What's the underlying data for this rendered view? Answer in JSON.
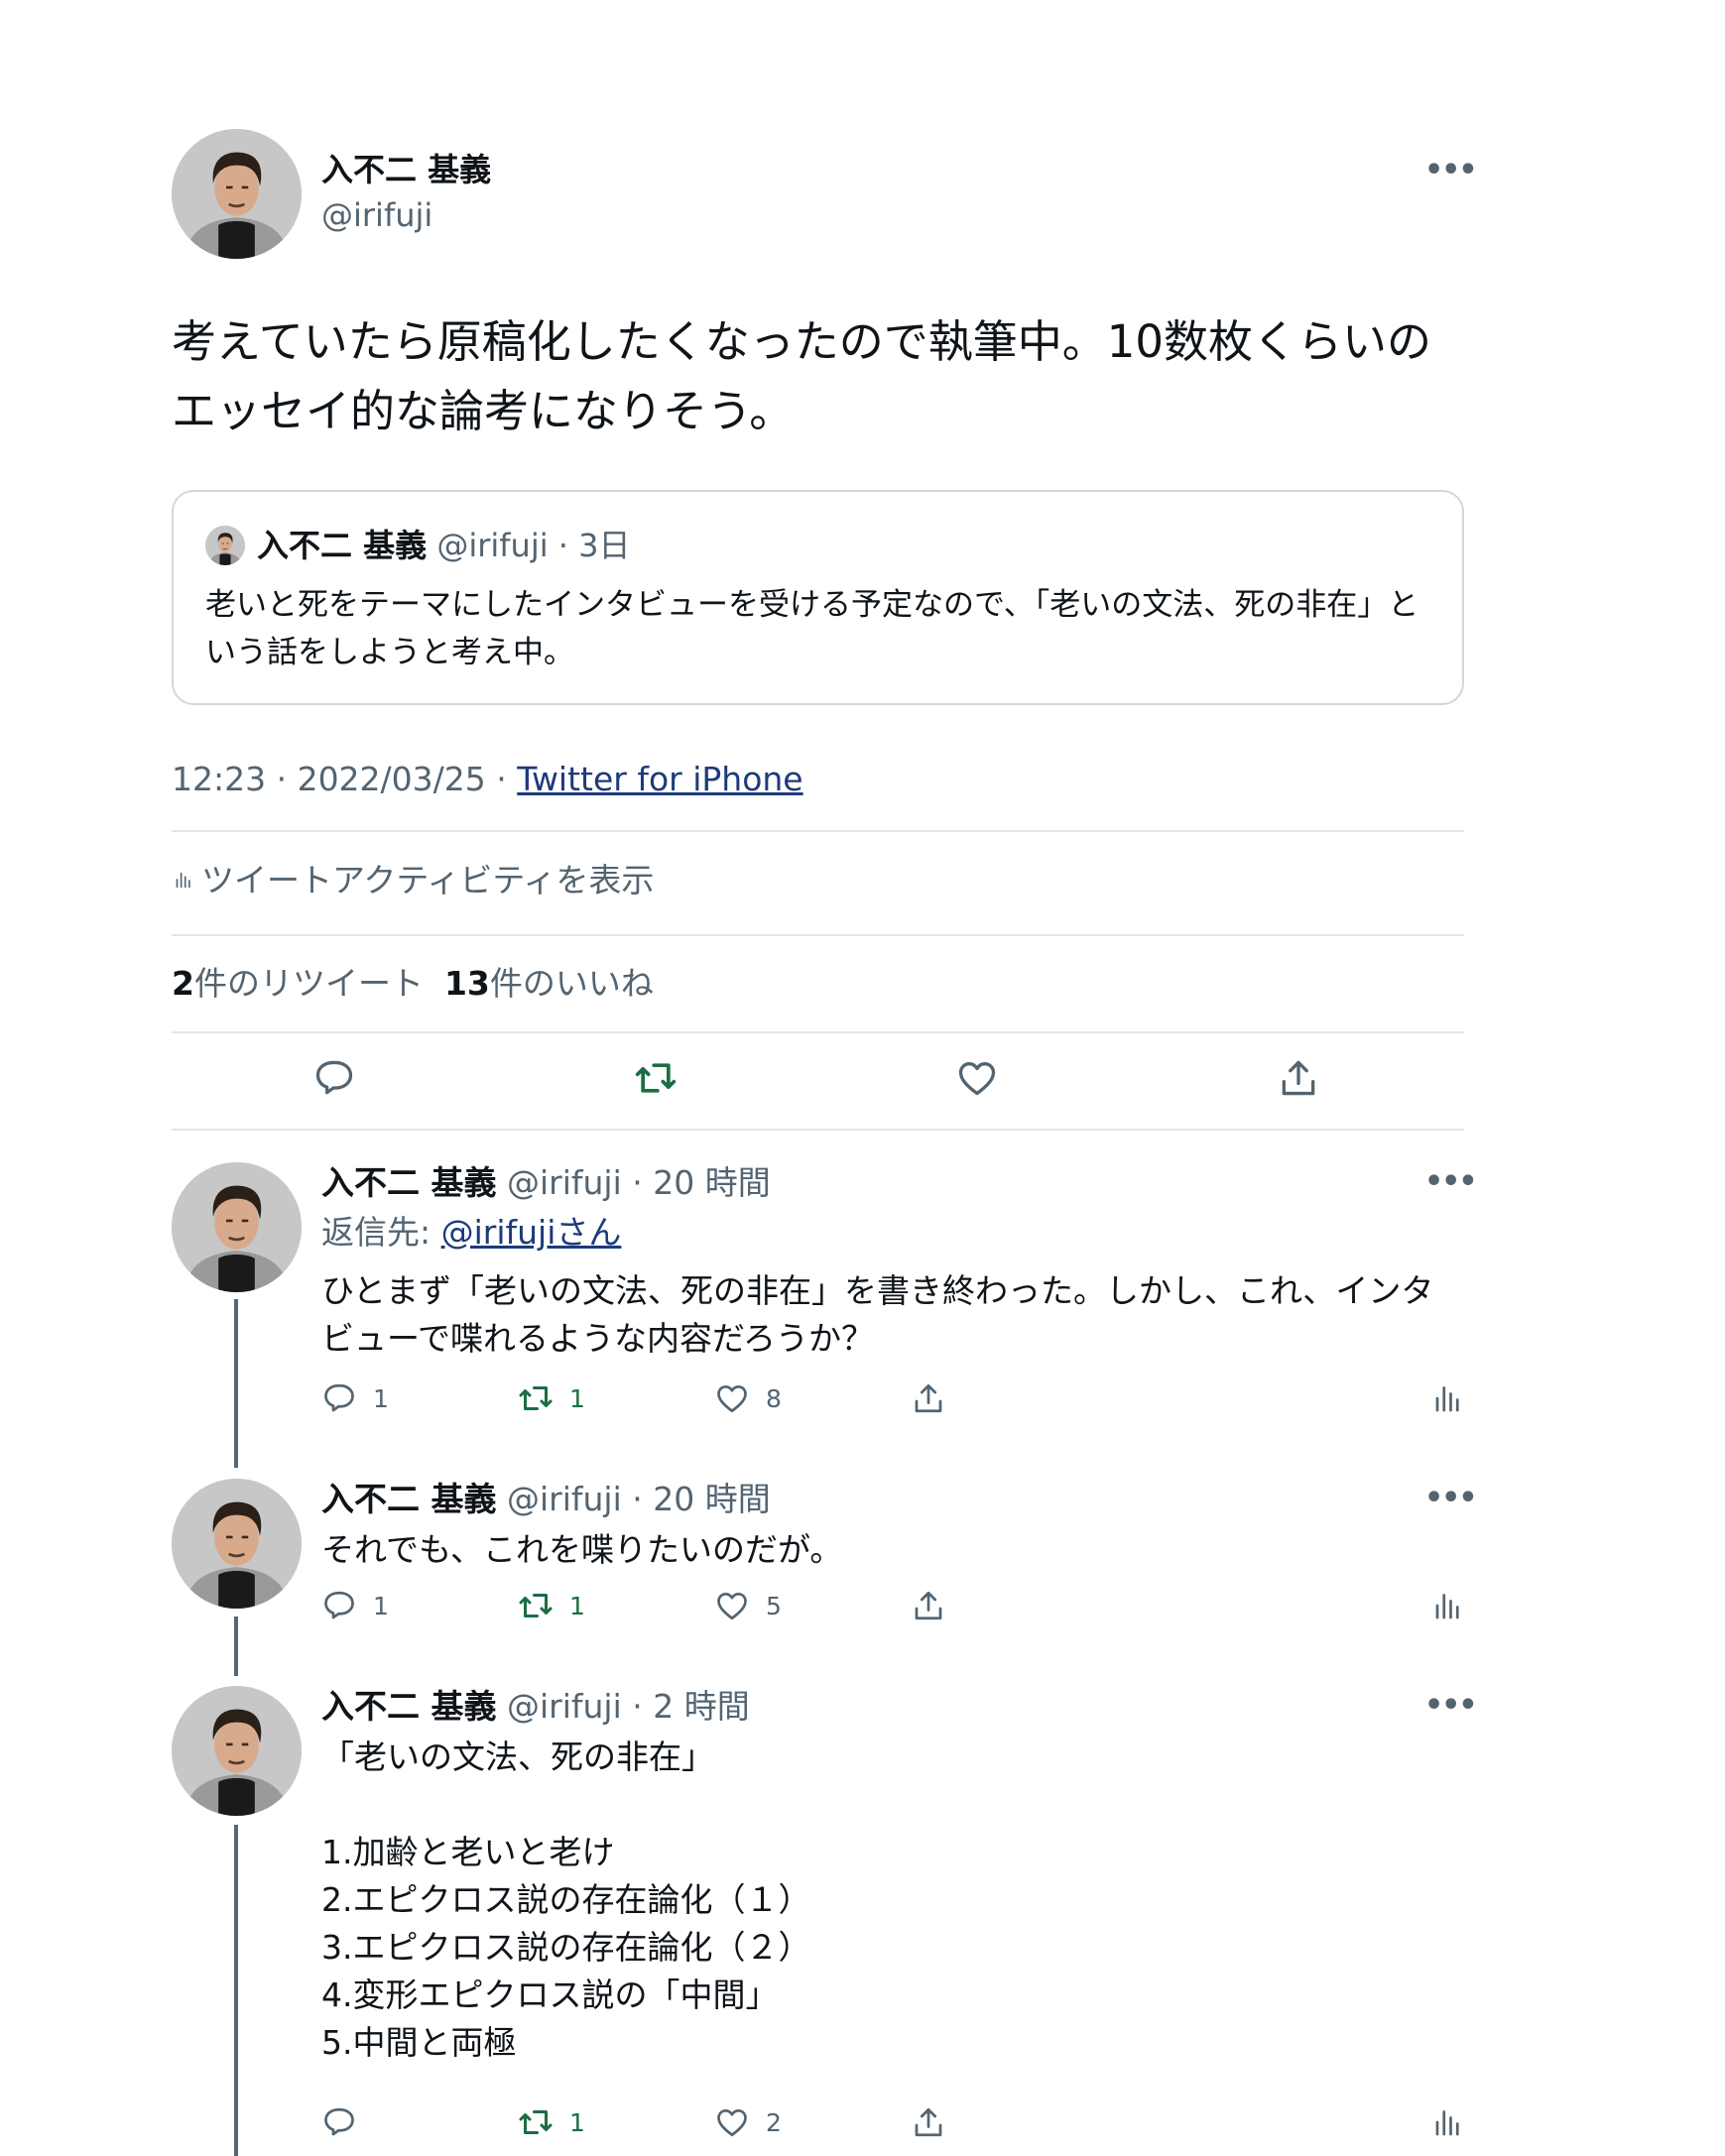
{
  "main": {
    "name": "入不二 基義",
    "handle": "@irifuji",
    "text": "考えていたら原稿化したくなったので執筆中。10数枚くらいのエッセイ的な論考になりそう。",
    "more_icon": "more-dots-icon"
  },
  "quote": {
    "name": "入不二 基義",
    "meta": "@irifuji · 3日",
    "text": "老いと死をテーマにしたインタビューを受ける予定なので、「老いの文法、死の非在」という話をしようと考え中。"
  },
  "timestamp": {
    "time": "12:23 · 2022/03/25 · ",
    "source": "Twitter for iPhone"
  },
  "activity_label": "ツイートアクティビティを表示",
  "stats": {
    "retweets_count": "2",
    "retweets_label": "件のリツイート",
    "likes_count": "13",
    "likes_label": "件のいいね"
  },
  "colors": {
    "retweet": "#1a6e45",
    "secondary": "#536471",
    "link": "#1d3a7a"
  },
  "replies": [
    {
      "name": "入不二 基義",
      "meta": " @irifuji · 20 時間",
      "reply_to_prefix": "返信先: ",
      "reply_to_handle": "@irifujiさん",
      "text": "ひとまず「老いの文法、死の非在」を書き終わった。しかし、これ、インタビューで喋れるような内容だろうか？",
      "replies": "1",
      "retweets": "1",
      "likes": "8"
    },
    {
      "name": "入不二 基義",
      "meta": " @irifuji · 20 時間",
      "text": "それでも、これを喋りたいのだが。",
      "replies": "1",
      "retweets": "1",
      "likes": "5"
    },
    {
      "name": "入不二 基義",
      "meta": " @irifuji · 2 時間",
      "text": "「老いの文法、死の非在」\n\n1.加齢と老いと老け\n2.エピクロス説の存在論化（１）\n3.エピクロス説の存在論化（２）\n4.変形エピクロス説の「中間」\n5.中間と両極",
      "replies": "",
      "retweets": "1",
      "likes": "2"
    }
  ]
}
